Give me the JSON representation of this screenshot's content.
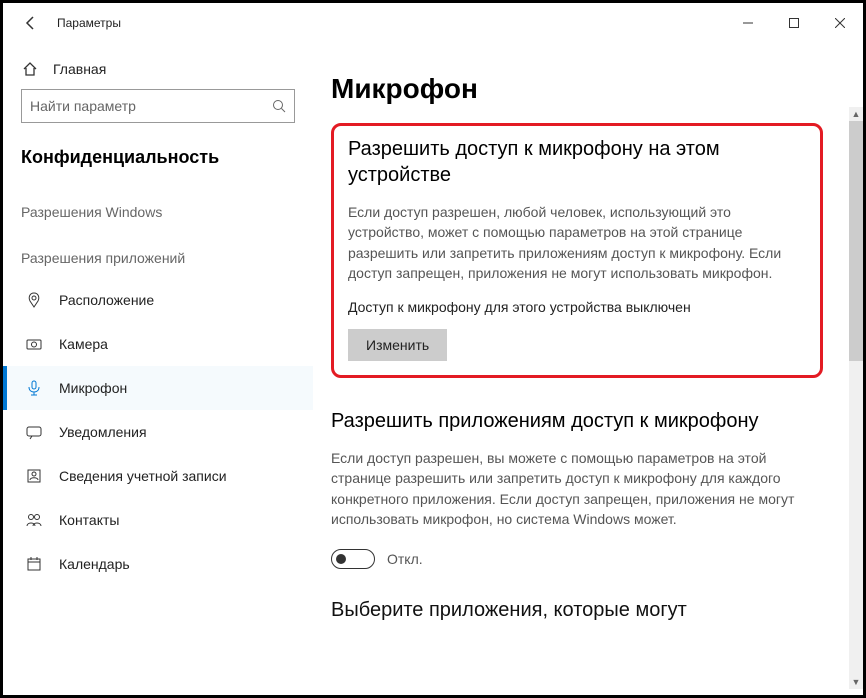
{
  "window": {
    "title": "Параметры"
  },
  "sidebar": {
    "home": "Главная",
    "search_placeholder": "Найти параметр",
    "heading": "Конфиденциальность",
    "group1": "Разрешения Windows",
    "group2": "Разрешения приложений",
    "items": [
      {
        "label": "Расположение"
      },
      {
        "label": "Камера"
      },
      {
        "label": "Микрофон"
      },
      {
        "label": "Уведомления"
      },
      {
        "label": "Сведения учетной записи"
      },
      {
        "label": "Контакты"
      },
      {
        "label": "Календарь"
      }
    ]
  },
  "main": {
    "title": "Микрофон",
    "section1": {
      "heading": "Разрешить доступ к микрофону на этом устройстве",
      "body": "Если доступ разрешен, любой человек, использующий это устройство, может с помощью параметров на этой странице разрешить или запретить приложениям доступ к микрофону. Если доступ запрещен, приложения не могут использовать микрофон.",
      "status": "Доступ к микрофону для этого устройства выключен",
      "button": "Изменить"
    },
    "section2": {
      "heading": "Разрешить приложениям доступ к микрофону",
      "body": "Если доступ разрешен, вы можете с помощью параметров на этой странице разрешить или запретить доступ к микрофону для каждого конкретного приложения. Если доступ запрещен, приложения не могут использовать микрофон, но система Windows может.",
      "toggle_label": "Откл."
    },
    "section3_partial": "Выберите приложения, которые могут"
  }
}
